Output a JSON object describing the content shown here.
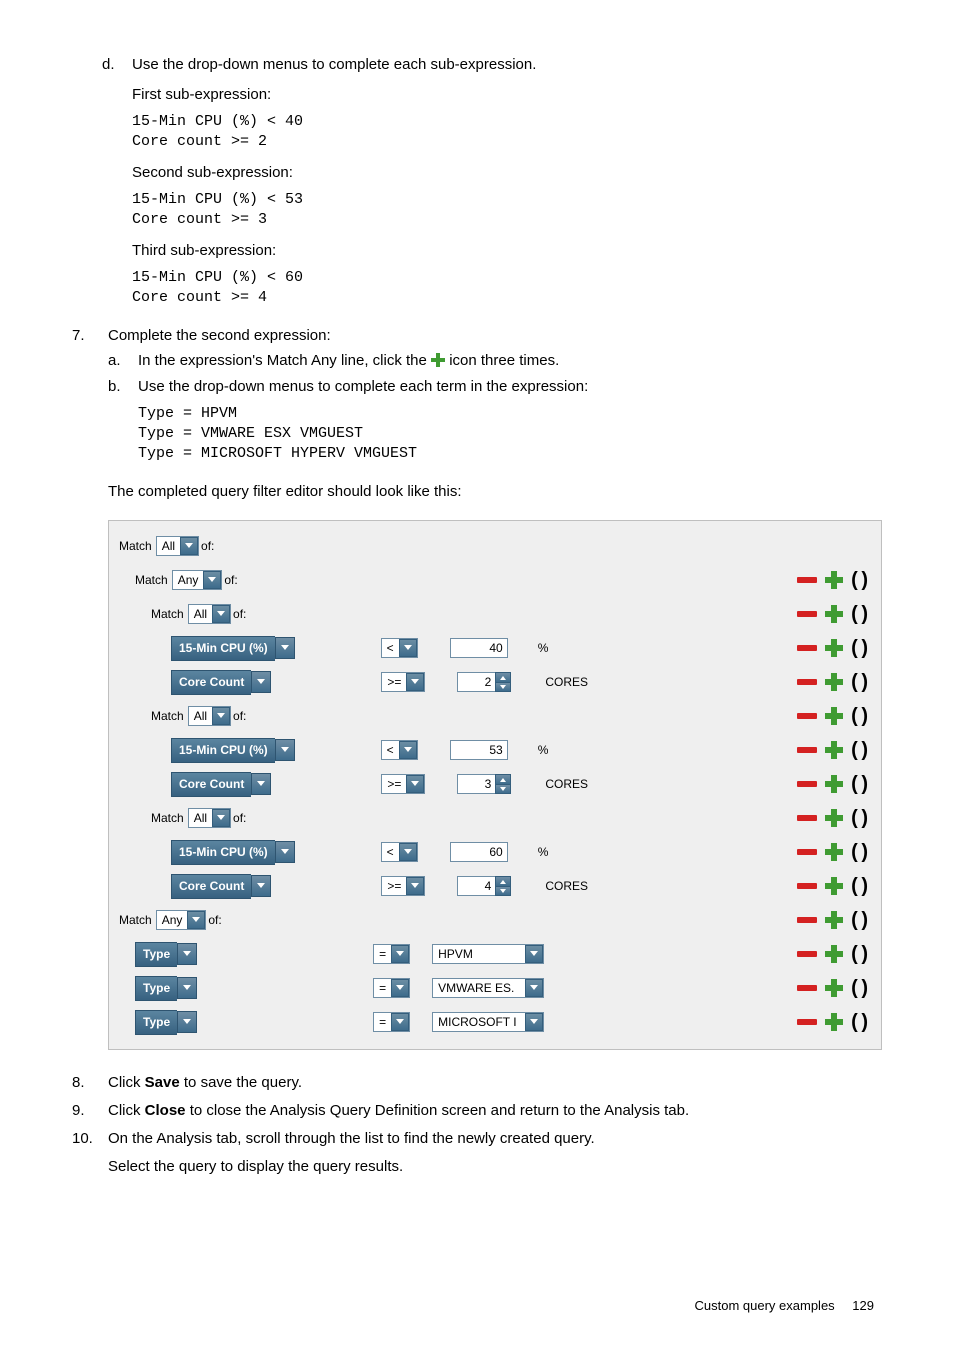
{
  "step_d": {
    "marker": "d.",
    "text": "Use the drop-down menus to complete each sub-expression.",
    "first_title": "First sub-expression:",
    "first_code": "15-Min CPU (%) < 40\nCore count >= 2",
    "second_title": "Second sub-expression:",
    "second_code": "15-Min CPU (%) < 53\nCore count >= 3",
    "third_title": "Third sub-expression:",
    "third_code": "15-Min CPU (%) < 60\nCore count >= 4"
  },
  "step7": {
    "num": "7.",
    "title": "Complete the second expression:",
    "a_marker": "a.",
    "a_pre": "In the expression's Match Any line, click the ",
    "a_post": " icon three times.",
    "b_marker": "b.",
    "b_text": "Use the drop-down menus to complete each term in the expression:",
    "code": "Type = HPVM\nType = VMWARE ESX VMGUEST\nType = MICROSOFT HYPERV VMGUEST",
    "summary": "The completed query filter editor should look like this:"
  },
  "filter": {
    "match_label": "Match",
    "of_label": "of:",
    "all": "All",
    "any": "Any",
    "metric_cpu": "15-Min CPU (%)",
    "metric_core": "Core Count",
    "metric_type": "Type",
    "op_lt": "<",
    "op_gte": ">=",
    "op_eq": "=",
    "unit_pct": "%",
    "unit_cores": "CORES",
    "rows": {
      "r1_val": "40",
      "r2_val": "2",
      "r3_val": "53",
      "r4_val": "3",
      "r5_val": "60",
      "r6_val": "4",
      "t1_val": "HPVM",
      "t2_val": "VMWARE ES.",
      "t3_val": "MICROSOFT I"
    }
  },
  "step8": {
    "num": "8.",
    "pre": "Click ",
    "bold": "Save",
    "post": " to save the query."
  },
  "step9": {
    "num": "9.",
    "pre": "Click ",
    "bold": "Close",
    "post": " to close the Analysis Query Definition screen and return to the Analysis tab."
  },
  "step10": {
    "num": "10.",
    "line1": "On the Analysis tab, scroll through the list to find the newly created query.",
    "line2": "Select the query to display the query results."
  },
  "footer": {
    "text": "Custom query examples",
    "page": "129"
  }
}
